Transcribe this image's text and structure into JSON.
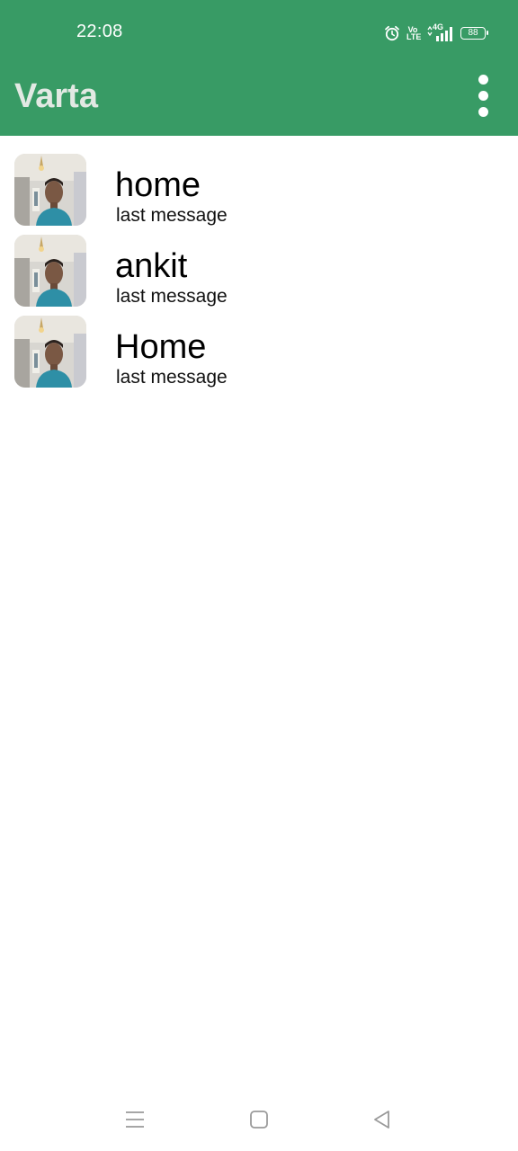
{
  "status_bar": {
    "time": "22:08",
    "volte_top": "Vo",
    "volte_bottom": "LTE",
    "network": "4G",
    "battery": "88",
    "icons": [
      "alarm-icon",
      "volte-icon",
      "signal-icon",
      "battery-icon"
    ]
  },
  "app_bar": {
    "title": "Varta",
    "menu_icon": "more-vert-icon"
  },
  "chats": [
    {
      "name": "home",
      "last_message": "last message",
      "avatar": "contact-photo"
    },
    {
      "name": "ankit",
      "last_message": "last message",
      "avatar": "contact-photo"
    },
    {
      "name": "Home",
      "last_message": "last message",
      "avatar": "contact-photo"
    }
  ],
  "nav_bar": {
    "buttons": [
      "menu-lines-icon",
      "home-square-icon",
      "back-triangle-icon"
    ]
  },
  "colors": {
    "primary": "#389b65",
    "title": "#e2e9e3",
    "background": "#ffffff"
  }
}
